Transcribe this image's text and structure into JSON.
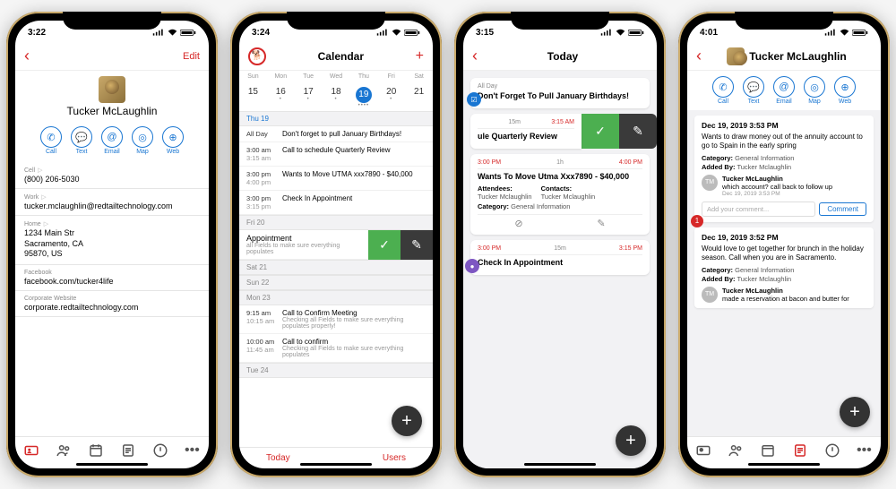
{
  "phone1": {
    "time": "3:22",
    "nav": {
      "edit": "Edit"
    },
    "contact_name": "Tucker McLaughlin",
    "actions": [
      {
        "label": "Call",
        "icon": "phone"
      },
      {
        "label": "Text",
        "icon": "text"
      },
      {
        "label": "Email",
        "icon": "email"
      },
      {
        "label": "Map",
        "icon": "map"
      },
      {
        "label": "Web",
        "icon": "web"
      }
    ],
    "fields": [
      {
        "label": "Cell",
        "value": "(800) 206-5030"
      },
      {
        "label": "Work",
        "value": "tucker.mclaughlin@redtailtechnology.com"
      },
      {
        "label": "Home",
        "value": "1234 Main Str\nSacramento, CA\n95870, US",
        "multiline": true
      },
      {
        "label": "Facebook",
        "value": "facebook.com/tucker4life"
      },
      {
        "label": "Corporate Website",
        "value": "corporate.redtailtechnology.com"
      }
    ]
  },
  "phone2": {
    "time": "3:24",
    "title": "Calendar",
    "add": "+",
    "week": {
      "days": [
        "Sun",
        "Mon",
        "Tue",
        "Wed",
        "Thu",
        "Fri",
        "Sat"
      ],
      "nums": [
        "15",
        "16",
        "17",
        "18",
        "19",
        "20",
        "21"
      ],
      "selected": 4
    },
    "sections": [
      {
        "header": "Thu 19",
        "blue": true,
        "events": [
          {
            "time": "All Day",
            "title": "Don't forget to pull January Birthdays!"
          },
          {
            "time": "3:00 am",
            "end": "3:15 am",
            "title": "Call to schedule Quarterly Review"
          },
          {
            "time": "3:00 pm",
            "end": "4:00 pm",
            "title": "Wants to Move UTMA xxx7890 - $40,000"
          },
          {
            "time": "3:00 pm",
            "end": "3:15 pm",
            "title": "Check In Appointment"
          }
        ]
      },
      {
        "header": "Fri 20",
        "swipe": {
          "title": "Appointment",
          "sub": "all Fields to make sure everything populates"
        }
      },
      {
        "header": "Sat 21"
      },
      {
        "header": "Sun 22"
      },
      {
        "header": "Mon 23",
        "events": [
          {
            "time": "9:15 am",
            "end": "10:15 am",
            "title": "Call to Confirm Meeting",
            "sub": "Checking all Fields to make sure everything populates properly!"
          },
          {
            "time": "10:00 am",
            "end": "11:45 am",
            "title": "Call to confirm",
            "sub": "Checking all Fields to make sure everything populates"
          }
        ]
      },
      {
        "header": "Tue 24"
      }
    ],
    "footer": {
      "left": "Today",
      "right": "Users"
    }
  },
  "phone3": {
    "time": "3:15",
    "title": "Today",
    "allday_label": "All Day",
    "allday_title": "Don't Forget To Pull January Birthdays!",
    "card_partial": {
      "duration": "15m",
      "end": "3:15 AM",
      "title": "ule Quarterly Review"
    },
    "card_main": {
      "start": "3:00 PM",
      "duration": "1h",
      "end": "4:00 PM",
      "title": "Wants To Move Utma Xxx7890 - $40,000",
      "attendees_label": "Attendees:",
      "attendees": "Tucker Mclaughlin",
      "contacts_label": "Contacts:",
      "contacts": "Tucker Mclaughlin",
      "category_label": "Category:",
      "category": "General Information"
    },
    "card_bottom": {
      "start": "3:00 PM",
      "duration": "15m",
      "end": "3:15 PM",
      "title": "Check In Appointment"
    }
  },
  "phone4": {
    "time": "4:01",
    "contact_name": "Tucker McLaughlin",
    "actions": [
      {
        "label": "Call"
      },
      {
        "label": "Text"
      },
      {
        "label": "Email"
      },
      {
        "label": "Map"
      },
      {
        "label": "Web"
      }
    ],
    "note1": {
      "date": "Dec 19, 2019 3:53 PM",
      "text": "Wants to draw money out of the annuity account to go to Spain in the early spring",
      "category_label": "Category:",
      "category": "General Information",
      "addedby_label": "Added By:",
      "addedby": "Tucker Mclaughlin",
      "comment": {
        "initials": "TM",
        "name": "Tucker McLaughlin",
        "text": "which account? call back to follow up",
        "date": "Dec 19, 2019 3:53 PM"
      },
      "placeholder": "Add your comment...",
      "button": "Comment",
      "badge": "1"
    },
    "note2": {
      "date": "Dec 19, 2019 3:52 PM",
      "text": "Would love to get together for brunch in the holiday season. Call when you are in Sacramento.",
      "category_label": "Category:",
      "category": "General Information",
      "addedby_label": "Added By:",
      "addedby": "Tucker Mclaughlin",
      "comment": {
        "initials": "TM",
        "name": "Tucker McLaughlin",
        "text": "made a reservation at bacon and butter for"
      }
    }
  },
  "icons": {
    "phone": "✆",
    "text": "✉",
    "email": "@",
    "map": "◎",
    "web": "⊕",
    "check": "✓",
    "pencil": "✎",
    "plus": "+"
  }
}
